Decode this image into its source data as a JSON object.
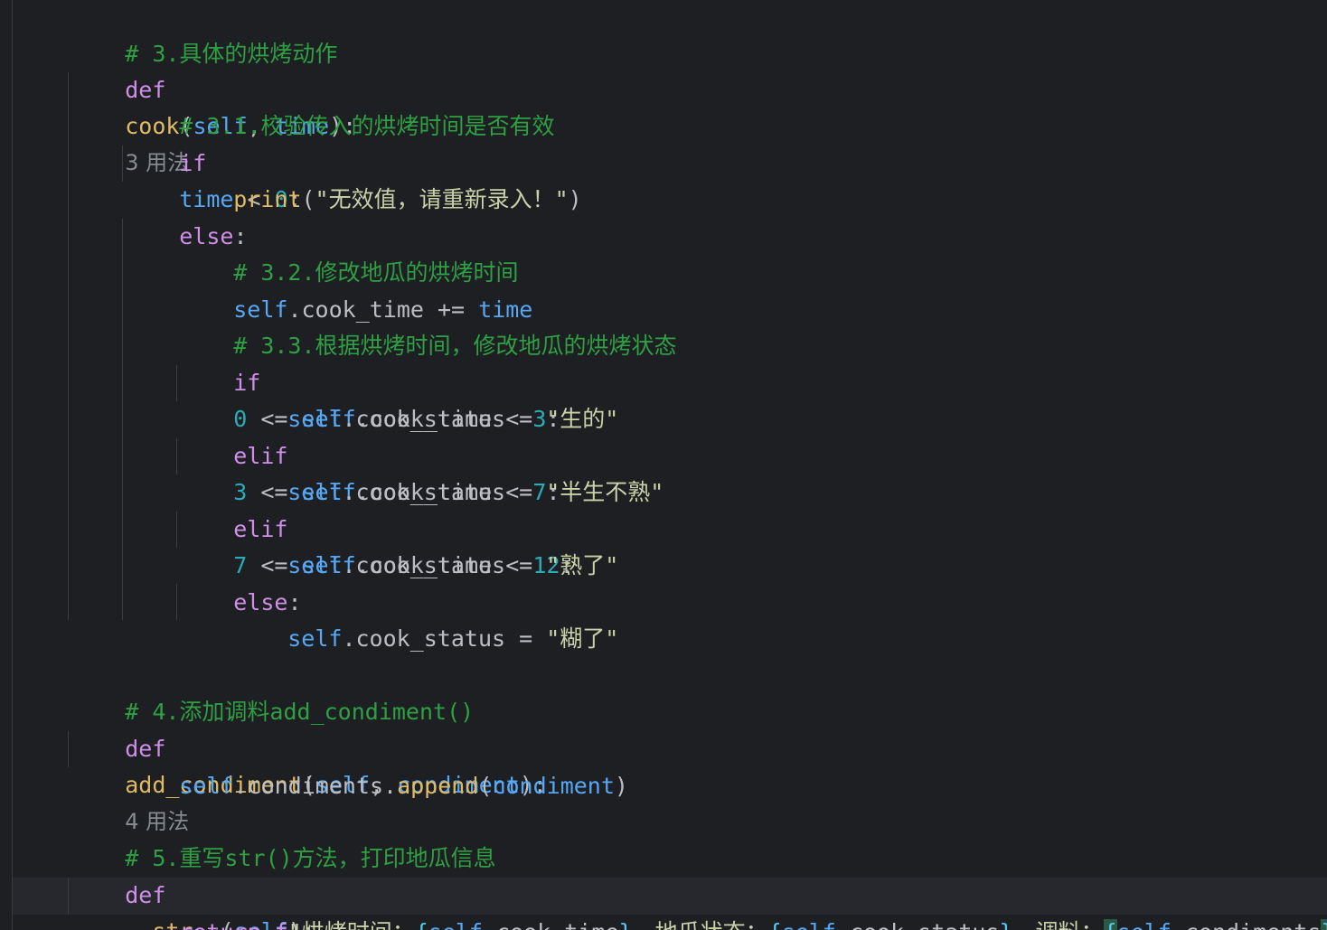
{
  "editor": {
    "lines": {
      "l0_comment": "# 3.具体的烘烤动作",
      "l1_def": "def",
      "l1_name": "cook",
      "l1_open": "(",
      "l1_self": "self",
      "l1_comma": ", ",
      "l1_param": "time",
      "l1_close": "):",
      "l1_hint": "3 用法",
      "l2_comment": "# 3.1.校验传入的烘烤时间是否有效",
      "l3_if": "if",
      "l3_var": "time",
      "l3_op": " < ",
      "l3_num": "0",
      "l3_colon": ":",
      "l4_print": "print",
      "l4_open": "(",
      "l4_str": "\"无效值，请重新录入！\"",
      "l4_close": ")",
      "l5_else": "else",
      "l5_colon": ":",
      "l6_comment": "# 3.2.修改地瓜的烘烤时间",
      "l7_self": "self",
      "l7_attr": ".cook_time += ",
      "l7_var": "time",
      "l8_comment": "# 3.3.根据烘烤时间，修改地瓜的烘烤状态",
      "l9_if": "if",
      "l9_num1": "0",
      "l9_op1": " <= ",
      "l9_self": "self",
      "l9_attr": ".cook_time < ",
      "l9_num2": "3",
      "l9_colon": ":",
      "l10_self": "self",
      "l10_attr": ".cook_status = ",
      "l10_str": "\"生的\"",
      "l11_elif": "elif",
      "l11_num1": "3",
      "l11_op1": " <= ",
      "l11_self": "self",
      "l11_attr": ".cook_time < ",
      "l11_num2": "7",
      "l11_colon": ":",
      "l12_self": "self",
      "l12_attr": ".cook_status = ",
      "l12_str": "\"半生不熟\"",
      "l13_elif": "elif",
      "l13_num1": "7",
      "l13_op1": " <= ",
      "l13_self": "self",
      "l13_attr": ".cook_time < ",
      "l13_num2": "12",
      "l13_colon": ":",
      "l14_self": "self",
      "l14_attr": ".cook_status = ",
      "l14_str": "\"熟了\"",
      "l15_else": "else",
      "l15_colon": ":",
      "l16_self": "self",
      "l16_attr": ".cook_status = ",
      "l16_str": "\"糊了\"",
      "l18_comment": "# 4.添加调料add_condiment()",
      "l19_def": "def",
      "l19_name": "add_condiment",
      "l19_open": "(",
      "l19_self": "self",
      "l19_comma": ", ",
      "l19_param": "condiment",
      "l19_close": "):",
      "l19_hint": "4 用法",
      "l20_self": "self",
      "l20_attr": ".condiments.",
      "l20_fn": "append",
      "l20_open": "(",
      "l20_param": "condiment",
      "l20_close": ")",
      "l22_comment": "# 5.重写str()方法，打印地瓜信息",
      "l23_def": "def",
      "l23_name": "__str__",
      "l23_open": "(",
      "l23_self": "self",
      "l23_close": "):",
      "l24_return": "return",
      "l24_f": " f",
      "l24_s1": "\"烘烤时间：",
      "l24_b1o": "{",
      "l24_self1": "self",
      "l24_attr1": ".cook_time",
      "l24_b1c": "}",
      "l24_s2": "，地瓜状态：",
      "l24_b2o": "{",
      "l24_self2": "self",
      "l24_attr2": ".cook_status",
      "l24_b2c": "}",
      "l24_s3": "，调料：",
      "l24_b3o": "{",
      "l24_self3": "self",
      "l24_attr3": ".condiments",
      "l24_b3c": "}",
      "l24_s4": "\""
    },
    "colors": {
      "background": "#1e1f22",
      "keyword": "#cf8ee8",
      "self": "#56a8f5",
      "function": "#e0bb65",
      "number": "#2aacb8",
      "comment": "#2ea043",
      "string": "#c9d1a8"
    }
  }
}
